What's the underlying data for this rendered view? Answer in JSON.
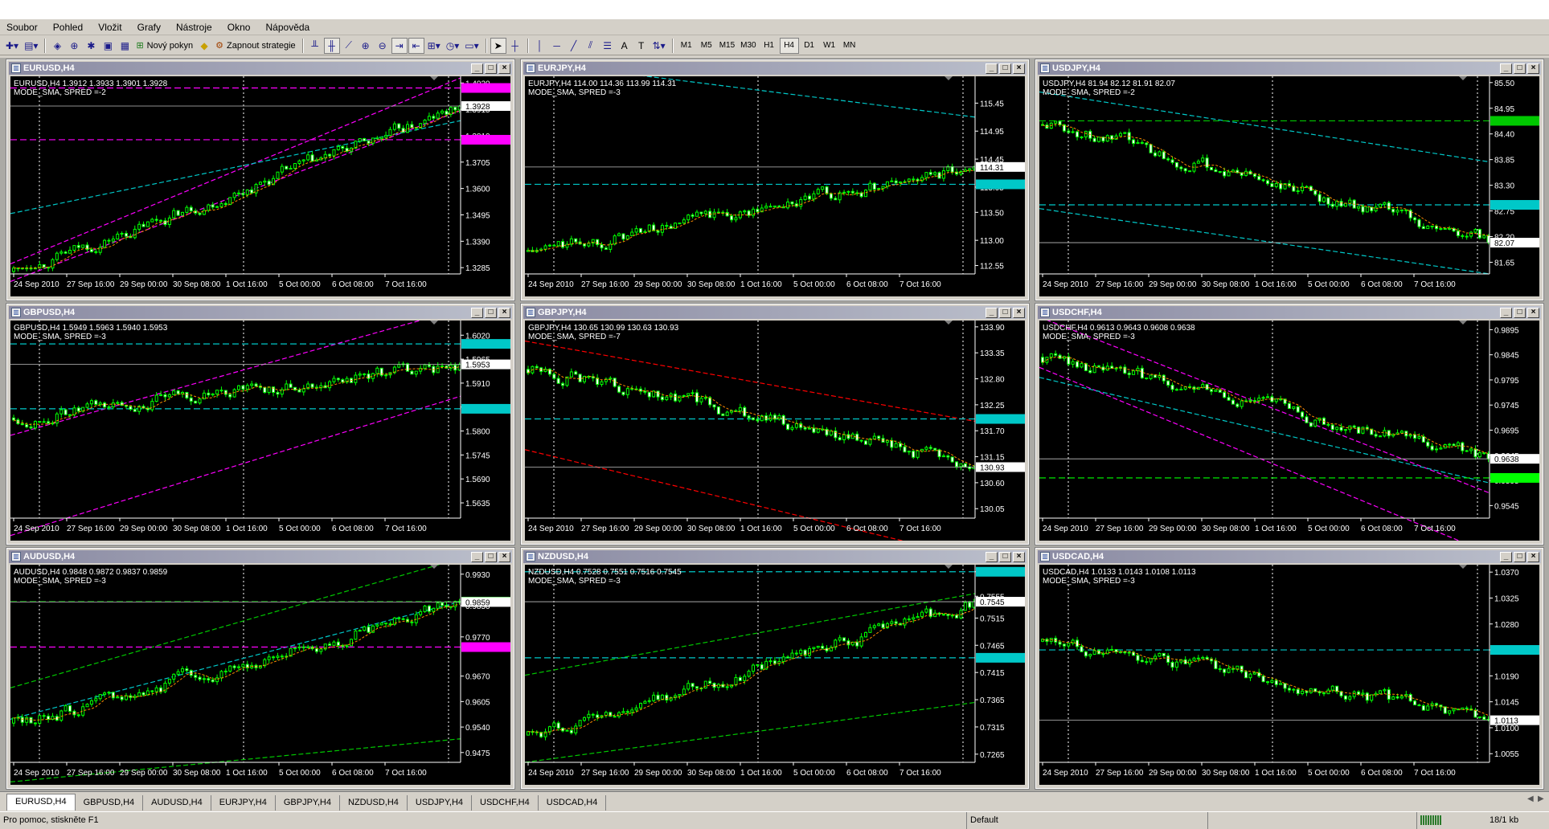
{
  "menu": [
    "Soubor",
    "Pohled",
    "Vložit",
    "Grafy",
    "Nástroje",
    "Okno",
    "Nápověda"
  ],
  "toolbar": {
    "new_order": "Nový pokyn",
    "autotrade": "Zapnout strategie",
    "timeframes": [
      "M1",
      "M5",
      "M15",
      "M30",
      "H1",
      "H4",
      "D1",
      "W1",
      "MN"
    ],
    "active_timeframe": "H4"
  },
  "colors": {
    "bull": "#00ff00",
    "bear": "#ffffff",
    "grid": "#ffffff",
    "sma": "#ff8c00",
    "background": "#000000"
  },
  "x_labels": [
    "24 Sep 2010",
    "27 Sep 16:00",
    "29 Sep 00:00",
    "30 Sep 08:00",
    "1 Oct 16:00",
    "5 Oct 00:00",
    "6 Oct 08:00",
    "7 Oct 16:00"
  ],
  "charts": [
    {
      "title": "EURUSD,H4",
      "info": "EURUSD,H4  1.3912 1.3933 1.3901 1.3928",
      "mode": "MODE_SMA, SPRED =-2",
      "ticks": [
        "1.4020",
        "1.3915",
        "1.3810",
        "1.3705",
        "1.3600",
        "1.3495",
        "1.3390",
        "1.3285"
      ],
      "ymin": 1.326,
      "ymax": 1.404,
      "start": 1.327,
      "end": 1.3928,
      "current": "1.3928",
      "hl": [
        {
          "value": 1.4,
          "color": "#ff00ff"
        },
        {
          "value": 1.3794,
          "color": "#ff00ff"
        }
      ],
      "trend": [
        {
          "color": "#ff00ff",
          "y1": 1.33,
          "y2": 1.404
        },
        {
          "color": "#ff00ff",
          "y1": 1.323,
          "y2": 1.391
        },
        {
          "color": "#00c8c8",
          "y1": 1.35,
          "y2": 1.387
        }
      ]
    },
    {
      "title": "EURJPY,H4",
      "info": "EURJPY,H4  114.00 114.36 113.99 114.31",
      "mode": "MODE_SMA, SPRED =-3",
      "ticks": [
        "115.45",
        "114.95",
        "114.45",
        "113.95",
        "113.50",
        "113.00",
        "112.55"
      ],
      "ymin": 112.4,
      "ymax": 115.9,
      "start": 112.8,
      "end": 114.31,
      "current": "114.31",
      "hl": [
        {
          "value": 114.0,
          "color": "#00c8c8"
        }
      ],
      "trend": [
        {
          "color": "#00c8c8",
          "y1": 116.2,
          "y2": 115.2
        }
      ]
    },
    {
      "title": "USDJPY,H4",
      "info": "USDJPY,H4  81.94 82.12 81.91 82.07",
      "mode": "MODE_SMA, SPRED =-2",
      "ticks": [
        "85.50",
        "84.95",
        "84.40",
        "83.85",
        "83.30",
        "82.75",
        "82.20",
        "81.65"
      ],
      "ymin": 81.4,
      "ymax": 85.6,
      "start": 84.6,
      "end": 82.07,
      "current": "82.07",
      "hl": [
        {
          "value": 84.68,
          "color": "#00c800"
        },
        {
          "value": 82.88,
          "color": "#00c8c8"
        }
      ],
      "trend": [
        {
          "color": "#00c8c8",
          "y1": 85.3,
          "y2": 83.8
        },
        {
          "color": "#00c8c8",
          "y1": 82.8,
          "y2": 81.4
        }
      ]
    },
    {
      "title": "GBPUSD,H4",
      "info": "GBPUSD,H4  1.5949 1.5963 1.5940 1.5953",
      "mode": "MODE_SMA, SPRED =-3",
      "ticks": [
        "1.6020",
        "1.5965",
        "1.5910",
        "1.5855",
        "1.5800",
        "1.5745",
        "1.5690",
        "1.5635"
      ],
      "ymin": 1.56,
      "ymax": 1.605,
      "start": 1.583,
      "end": 1.5953,
      "current": "1.5953",
      "hl": [
        {
          "value": 1.6,
          "color": "#00c8c8"
        },
        {
          "value": 1.5851,
          "color": "#00c8c8"
        }
      ],
      "trend": [
        {
          "color": "#ff00ff",
          "y1": 1.579,
          "y2": 1.608
        },
        {
          "color": "#ff00ff",
          "y1": 1.556,
          "y2": 1.588
        }
      ]
    },
    {
      "title": "GBPJPY,H4",
      "info": "GBPJPY,H4  130.65 130.99 130.63 130.93",
      "mode": "MODE_SMA, SPRED =-7",
      "ticks": [
        "133.90",
        "133.35",
        "132.80",
        "132.25",
        "131.70",
        "131.15",
        "130.60",
        "130.05"
      ],
      "ymin": 129.85,
      "ymax": 134.0,
      "start": 133.0,
      "end": 130.93,
      "current": "130.93",
      "hl": [
        {
          "value": 131.95,
          "color": "#00c8c8"
        }
      ],
      "trend": [
        {
          "color": "#ff0000",
          "y1": 133.6,
          "y2": 131.9
        },
        {
          "color": "#ff0000",
          "y1": 131.3,
          "y2": 129.0
        }
      ]
    },
    {
      "title": "USDCHF,H4",
      "info": "USDCHF,H4  0.9613 0.9643 0.9608 0.9638",
      "mode": "MODE_SMA, SPRED =-3",
      "ticks": [
        "0.9895",
        "0.9845",
        "0.9795",
        "0.9745",
        "0.9695",
        "0.9645",
        "0.9595",
        "0.9545"
      ],
      "ymin": 0.952,
      "ymax": 0.991,
      "start": 0.984,
      "end": 0.9638,
      "current": "0.9638",
      "hl": [
        {
          "value": 0.96,
          "color": "#00ff00"
        }
      ],
      "trend": [
        {
          "color": "#ff00ff",
          "y1": 0.992,
          "y2": 0.957
        },
        {
          "color": "#ff00ff",
          "y1": 0.982,
          "y2": 0.945
        },
        {
          "color": "#00c8c8",
          "y1": 0.98,
          "y2": 0.959
        }
      ]
    },
    {
      "title": "AUDUSD,H4",
      "info": "AUDUSD,H4  0.9848 0.9872 0.9837 0.9859",
      "mode": "MODE_SMA, SPRED =-3",
      "ticks": [
        "0.9930",
        "0.9850",
        "0.9770",
        "0.9670",
        "0.9605",
        "0.9540",
        "0.9475"
      ],
      "ymin": 0.945,
      "ymax": 0.995,
      "start": 0.955,
      "end": 0.9859,
      "current": "0.9859",
      "hl": [
        {
          "value": 0.986,
          "color": "#00c800"
        },
        {
          "value": 0.9744,
          "color": "#ff00ff"
        }
      ],
      "trend": [
        {
          "color": "#00c800",
          "y1": 0.964,
          "y2": 0.997
        },
        {
          "color": "#00c8c8",
          "y1": 0.956,
          "y2": 0.986
        },
        {
          "color": "#00c800",
          "y1": 0.94,
          "y2": 0.951
        }
      ]
    },
    {
      "title": "NZDUSD,H4",
      "info": "NZDUSD,H4  0.7528 0.7551 0.7516 0.7545",
      "mode": "MODE_SMA, SPRED =-3",
      "ticks": [
        "0.7600",
        "0.7555",
        "0.7515",
        "0.7465",
        "0.7415",
        "0.7365",
        "0.7315",
        "0.7265"
      ],
      "ymin": 0.725,
      "ymax": 0.761,
      "start": 0.73,
      "end": 0.7545,
      "current": "0.7545",
      "hl": [
        {
          "value": 0.76,
          "color": "#00c8c8"
        },
        {
          "value": 0.7442,
          "color": "#00c8c8"
        }
      ],
      "trend": [
        {
          "color": "#00c800",
          "y1": 0.741,
          "y2": 0.756
        },
        {
          "color": "#00c800",
          "y1": 0.725,
          "y2": 0.736
        }
      ]
    },
    {
      "title": "USDCAD,H4",
      "info": "USDCAD,H4  1.0133 1.0143 1.0108 1.0113",
      "mode": "MODE_SMA, SPRED =-3",
      "ticks": [
        "1.0370",
        "1.0325",
        "1.0280",
        "1.0235",
        "1.0190",
        "1.0145",
        "1.0100",
        "1.0055"
      ],
      "ymin": 1.004,
      "ymax": 1.038,
      "start": 1.025,
      "end": 1.0113,
      "current": "1.0113",
      "hl": [
        {
          "value": 1.0235,
          "color": "#00c8c8"
        }
      ],
      "trend": []
    }
  ],
  "tabs": [
    "EURUSD,H4",
    "GBPUSD,H4",
    "AUDUSD,H4",
    "EURJPY,H4",
    "GBPJPY,H4",
    "NZDUSD,H4",
    "USDJPY,H4",
    "USDCHF,H4",
    "USDCAD,H4"
  ],
  "status": {
    "help": "Pro pomoc, stiskněte F1",
    "profile": "Default",
    "traffic": "18/1 kb"
  }
}
